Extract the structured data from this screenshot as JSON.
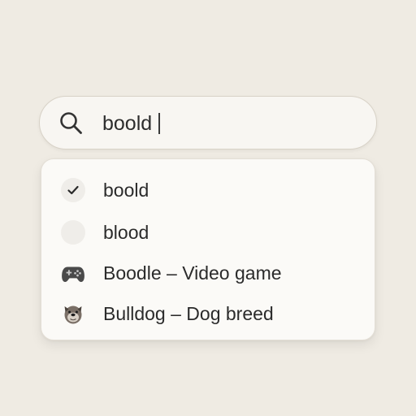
{
  "search": {
    "value": "boold",
    "icon": "search-icon"
  },
  "suggestions": [
    {
      "label": "boold",
      "icon": "checkmark-icon"
    },
    {
      "label": "blood",
      "icon": "empty-circle-icon"
    },
    {
      "label": "Boodle – Video game",
      "icon": "gamepad-icon"
    },
    {
      "label": "Bulldog – Dog breed",
      "icon": "bulldog-icon"
    }
  ],
  "colors": {
    "background": "#efebe3",
    "panel": "#fbfaf7",
    "text": "#2b2b2b"
  }
}
